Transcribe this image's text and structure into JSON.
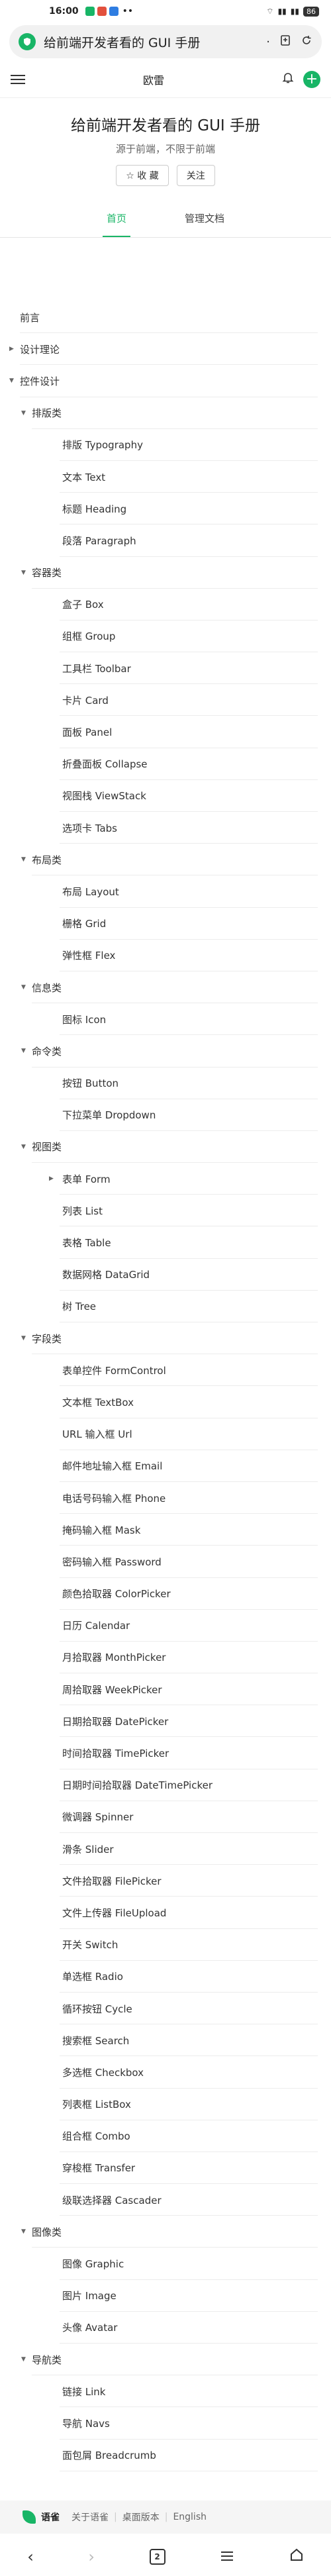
{
  "status": {
    "time": "16:00",
    "dots": "••",
    "battery": "86"
  },
  "address": {
    "title": "给前端开发者看的 GUI 手册"
  },
  "header": {
    "site_name": "欧雷"
  },
  "book": {
    "title": "给前端开发者看的 GUI 手册",
    "subtitle": "源于前端，不限于前端",
    "collect_label": "收 藏",
    "follow_label": "关注"
  },
  "tabs": [
    {
      "label": "首页"
    },
    {
      "label": "管理文档"
    }
  ],
  "toc": [
    {
      "label": "前言",
      "level": 0,
      "caret": ""
    },
    {
      "label": "设计理论",
      "level": 0,
      "caret": "▶"
    },
    {
      "label": "控件设计",
      "level": 0,
      "caret": "▼"
    },
    {
      "label": "排版类",
      "level": 1,
      "caret": "▼"
    },
    {
      "label": "排版 Typography",
      "level": 2,
      "caret": ""
    },
    {
      "label": "文本 Text",
      "level": 2,
      "caret": ""
    },
    {
      "label": "标题 Heading",
      "level": 2,
      "caret": ""
    },
    {
      "label": "段落 Paragraph",
      "level": 2,
      "caret": ""
    },
    {
      "label": "容器类",
      "level": 1,
      "caret": "▼"
    },
    {
      "label": "盒子 Box",
      "level": 2,
      "caret": ""
    },
    {
      "label": "组框 Group",
      "level": 2,
      "caret": ""
    },
    {
      "label": "工具栏 Toolbar",
      "level": 2,
      "caret": ""
    },
    {
      "label": "卡片 Card",
      "level": 2,
      "caret": ""
    },
    {
      "label": "面板 Panel",
      "level": 2,
      "caret": ""
    },
    {
      "label": "折叠面板 Collapse",
      "level": 2,
      "caret": ""
    },
    {
      "label": "视图栈 ViewStack",
      "level": 2,
      "caret": ""
    },
    {
      "label": "选项卡 Tabs",
      "level": 2,
      "caret": ""
    },
    {
      "label": "布局类",
      "level": 1,
      "caret": "▼"
    },
    {
      "label": "布局 Layout",
      "level": 2,
      "caret": ""
    },
    {
      "label": "栅格 Grid",
      "level": 2,
      "caret": ""
    },
    {
      "label": "弹性框 Flex",
      "level": 2,
      "caret": ""
    },
    {
      "label": "信息类",
      "level": 1,
      "caret": "▼"
    },
    {
      "label": "图标 Icon",
      "level": 2,
      "caret": ""
    },
    {
      "label": "命令类",
      "level": 1,
      "caret": "▼"
    },
    {
      "label": "按钮 Button",
      "level": 2,
      "caret": ""
    },
    {
      "label": "下拉菜单 Dropdown",
      "level": 2,
      "caret": ""
    },
    {
      "label": "视图类",
      "level": 1,
      "caret": "▼"
    },
    {
      "label": "表单 Form",
      "level": 2,
      "caret": "▶"
    },
    {
      "label": "列表 List",
      "level": 2,
      "caret": ""
    },
    {
      "label": "表格 Table",
      "level": 2,
      "caret": ""
    },
    {
      "label": "数据网格 DataGrid",
      "level": 2,
      "caret": ""
    },
    {
      "label": "树 Tree",
      "level": 2,
      "caret": ""
    },
    {
      "label": "字段类",
      "level": 1,
      "caret": "▼"
    },
    {
      "label": "表单控件 FormControl",
      "level": 2,
      "caret": ""
    },
    {
      "label": "文本框 TextBox",
      "level": 2,
      "caret": ""
    },
    {
      "label": "URL 输入框 Url",
      "level": 2,
      "caret": ""
    },
    {
      "label": "邮件地址输入框 Email",
      "level": 2,
      "caret": ""
    },
    {
      "label": "电话号码输入框 Phone",
      "level": 2,
      "caret": ""
    },
    {
      "label": "掩码输入框 Mask",
      "level": 2,
      "caret": ""
    },
    {
      "label": "密码输入框 Password",
      "level": 2,
      "caret": ""
    },
    {
      "label": "颜色拾取器 ColorPicker",
      "level": 2,
      "caret": ""
    },
    {
      "label": "日历 Calendar",
      "level": 2,
      "caret": ""
    },
    {
      "label": "月拾取器 MonthPicker",
      "level": 2,
      "caret": ""
    },
    {
      "label": "周拾取器 WeekPicker",
      "level": 2,
      "caret": ""
    },
    {
      "label": "日期拾取器 DatePicker",
      "level": 2,
      "caret": ""
    },
    {
      "label": "时间拾取器 TimePicker",
      "level": 2,
      "caret": ""
    },
    {
      "label": "日期时间拾取器 DateTimePicker",
      "level": 2,
      "caret": ""
    },
    {
      "label": "微调器 Spinner",
      "level": 2,
      "caret": ""
    },
    {
      "label": "滑条 Slider",
      "level": 2,
      "caret": ""
    },
    {
      "label": "文件拾取器 FilePicker",
      "level": 2,
      "caret": ""
    },
    {
      "label": "文件上传器 FileUpload",
      "level": 2,
      "caret": ""
    },
    {
      "label": "开关 Switch",
      "level": 2,
      "caret": ""
    },
    {
      "label": "单选框 Radio",
      "level": 2,
      "caret": ""
    },
    {
      "label": "循环按钮 Cycle",
      "level": 2,
      "caret": ""
    },
    {
      "label": "搜索框 Search",
      "level": 2,
      "caret": ""
    },
    {
      "label": "多选框 Checkbox",
      "level": 2,
      "caret": ""
    },
    {
      "label": "列表框 ListBox",
      "level": 2,
      "caret": ""
    },
    {
      "label": "组合框 Combo",
      "level": 2,
      "caret": ""
    },
    {
      "label": "穿梭框 Transfer",
      "level": 2,
      "caret": ""
    },
    {
      "label": "级联选择器 Cascader",
      "level": 2,
      "caret": ""
    },
    {
      "label": "图像类",
      "level": 1,
      "caret": "▼"
    },
    {
      "label": "图像 Graphic",
      "level": 2,
      "caret": ""
    },
    {
      "label": "图片 Image",
      "level": 2,
      "caret": ""
    },
    {
      "label": "头像 Avatar",
      "level": 2,
      "caret": ""
    },
    {
      "label": "导航类",
      "level": 1,
      "caret": "▼"
    },
    {
      "label": "链接 Link",
      "level": 2,
      "caret": ""
    },
    {
      "label": "导航 Navs",
      "level": 2,
      "caret": ""
    },
    {
      "label": "面包屑 Breadcrumb",
      "level": 2,
      "caret": ""
    }
  ],
  "footer": {
    "brand": "语雀",
    "about": "关于语雀",
    "desktop": "桌面版本",
    "english": "English"
  },
  "nav": {
    "tab_count": "2"
  },
  "colors": {
    "accent": "#18b566"
  }
}
